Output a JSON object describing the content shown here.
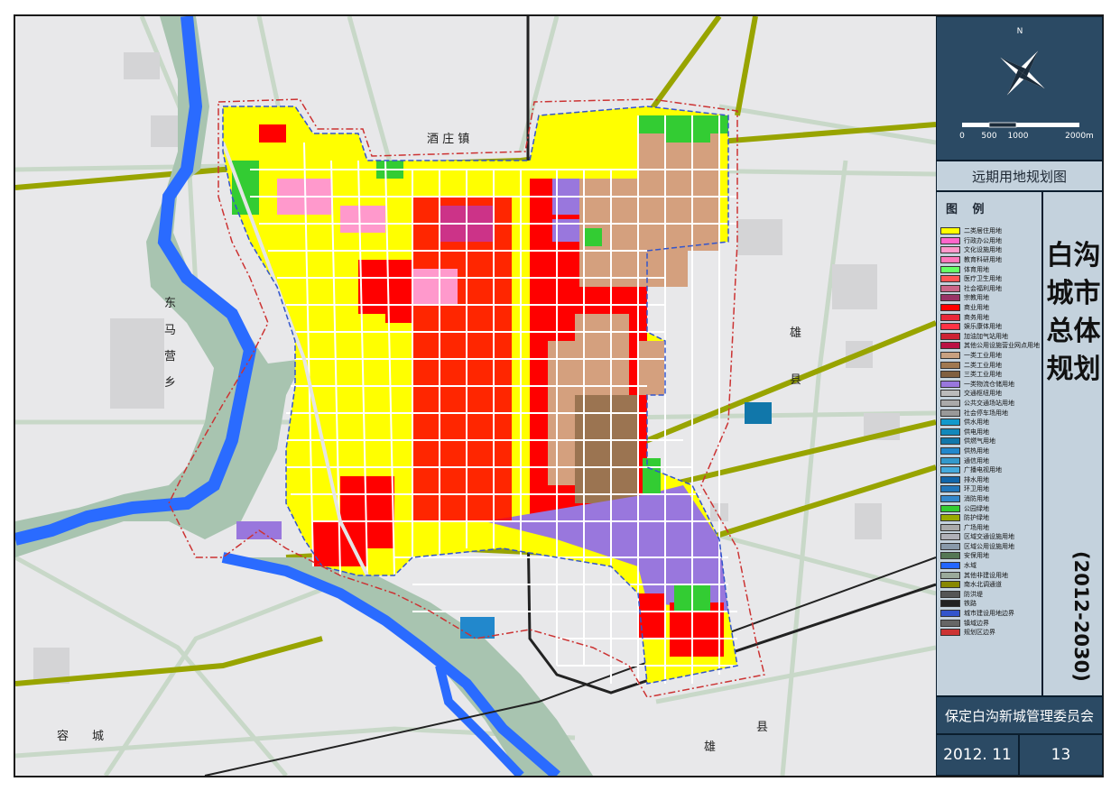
{
  "map": {
    "place_labels": {
      "jiuzhuang": "酒 庄 镇",
      "dongma": "东",
      "dongma2": "马",
      "dongma3": "营",
      "dongma4": "乡",
      "xiong_top": "雄",
      "xiong_top2": "县",
      "xiong_bottom": "雄",
      "xiong_bottom2": "县",
      "rong": "容",
      "rong2": "城"
    }
  },
  "compass": {
    "north_label": "N"
  },
  "scale": {
    "labels": [
      "0",
      "500",
      "1000",
      "2000m"
    ]
  },
  "panel": {
    "map_title": "远期用地规划图",
    "legend_heading": "图 例",
    "vertical_title": "白沟城市总体规划",
    "years": "(2012-2030)",
    "organization": "保定白沟新城管理委员会",
    "date": "2012. 11",
    "page_number": "13"
  },
  "legend": [
    {
      "label": "二类居住用地",
      "color": "#ffff00"
    },
    {
      "label": "行政办公用地",
      "color": "#ff66cc"
    },
    {
      "label": "文化设施用地",
      "color": "#ff99cc"
    },
    {
      "label": "教育科研用地",
      "color": "#ff77bb"
    },
    {
      "label": "体育用地",
      "color": "#66ff66"
    },
    {
      "label": "医疗卫生用地",
      "color": "#ff5555"
    },
    {
      "label": "社会福利用地",
      "color": "#cc6688"
    },
    {
      "label": "宗教用地",
      "color": "#993366"
    },
    {
      "label": "商业用地",
      "color": "#ff0000"
    },
    {
      "label": "商务用地",
      "color": "#e8293a"
    },
    {
      "label": "娱乐康体用地",
      "color": "#ff3344"
    },
    {
      "label": "加油加气站用地",
      "color": "#cc2233"
    },
    {
      "label": "其他公用设施营业网点用地",
      "color": "#bb1144"
    },
    {
      "label": "一类工业用地",
      "color": "#c8a080"
    },
    {
      "label": "二类工业用地",
      "color": "#a07850"
    },
    {
      "label": "三类工业用地",
      "color": "#806040"
    },
    {
      "label": "一类物流仓储用地",
      "color": "#9977dd"
    },
    {
      "label": "交通枢纽用地",
      "color": "#bbbbbb"
    },
    {
      "label": "公共交通场站用地",
      "color": "#aaaaaa"
    },
    {
      "label": "社会停车场用地",
      "color": "#999999"
    },
    {
      "label": "供水用地",
      "color": "#1199cc"
    },
    {
      "label": "供电用地",
      "color": "#1188bb"
    },
    {
      "label": "供燃气用地",
      "color": "#1177aa"
    },
    {
      "label": "供热用地",
      "color": "#2288cc"
    },
    {
      "label": "通信用地",
      "color": "#3399cc"
    },
    {
      "label": "广播电视用地",
      "color": "#44aadd"
    },
    {
      "label": "排水用地",
      "color": "#1166aa"
    },
    {
      "label": "环卫用地",
      "color": "#2277bb"
    },
    {
      "label": "消防用地",
      "color": "#3388cc"
    },
    {
      "label": "公园绿地",
      "color": "#33cc33"
    },
    {
      "label": "防护绿地",
      "color": "#99aa00"
    },
    {
      "label": "广场用地",
      "color": "#aaaaaa"
    },
    {
      "label": "区域交通设施用地",
      "color": "#b0b0b8"
    },
    {
      "label": "区域公用设施用地",
      "color": "#8899aa"
    },
    {
      "label": "安保用地",
      "color": "#557755"
    },
    {
      "label": "水域",
      "color": "#2266ff"
    },
    {
      "label": "其他非建设用地",
      "color": "#9aaa9a"
    },
    {
      "label": "南水北调通道",
      "color": "#888800"
    },
    {
      "label": "防洪堤",
      "color": "#555555"
    },
    {
      "label": "铁路",
      "color": "#222222"
    },
    {
      "label": "城市建设用地边界",
      "color": "#3355cc"
    },
    {
      "label": "镇域边界",
      "color": "#666666"
    },
    {
      "label": "规划区边界",
      "color": "#cc3333"
    }
  ]
}
